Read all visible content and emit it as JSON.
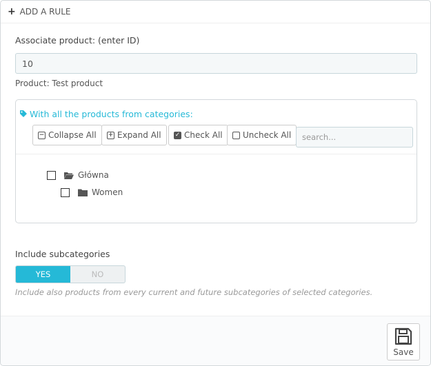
{
  "panel": {
    "title": "ADD A RULE",
    "title_icon": "plus-icon"
  },
  "associate": {
    "label": "Associate product: (enter ID)",
    "value": "10",
    "product_text": "Product: Test product"
  },
  "tree": {
    "title": "With all the products from categories:",
    "title_icon": "tag-icon",
    "buttons": {
      "collapse": "Collapse All",
      "expand": "Expand All",
      "check": "Check All",
      "uncheck": "Uncheck All"
    },
    "search_placeholder": "search...",
    "nodes": [
      {
        "label": "Główna",
        "icon": "folder-open-icon",
        "checked": false
      },
      {
        "label": "Women",
        "icon": "folder-icon",
        "checked": false
      }
    ]
  },
  "subcategories": {
    "label": "Include subcategories",
    "yes": "YES",
    "no": "NO",
    "selected": "YES",
    "help": "Include also products from every current and future subcategories of selected categories."
  },
  "footer": {
    "save_label": "Save",
    "save_icon": "floppy-disk-icon"
  },
  "colors": {
    "accent": "#25b9d7",
    "text": "#555555",
    "border": "#d3d8db"
  }
}
